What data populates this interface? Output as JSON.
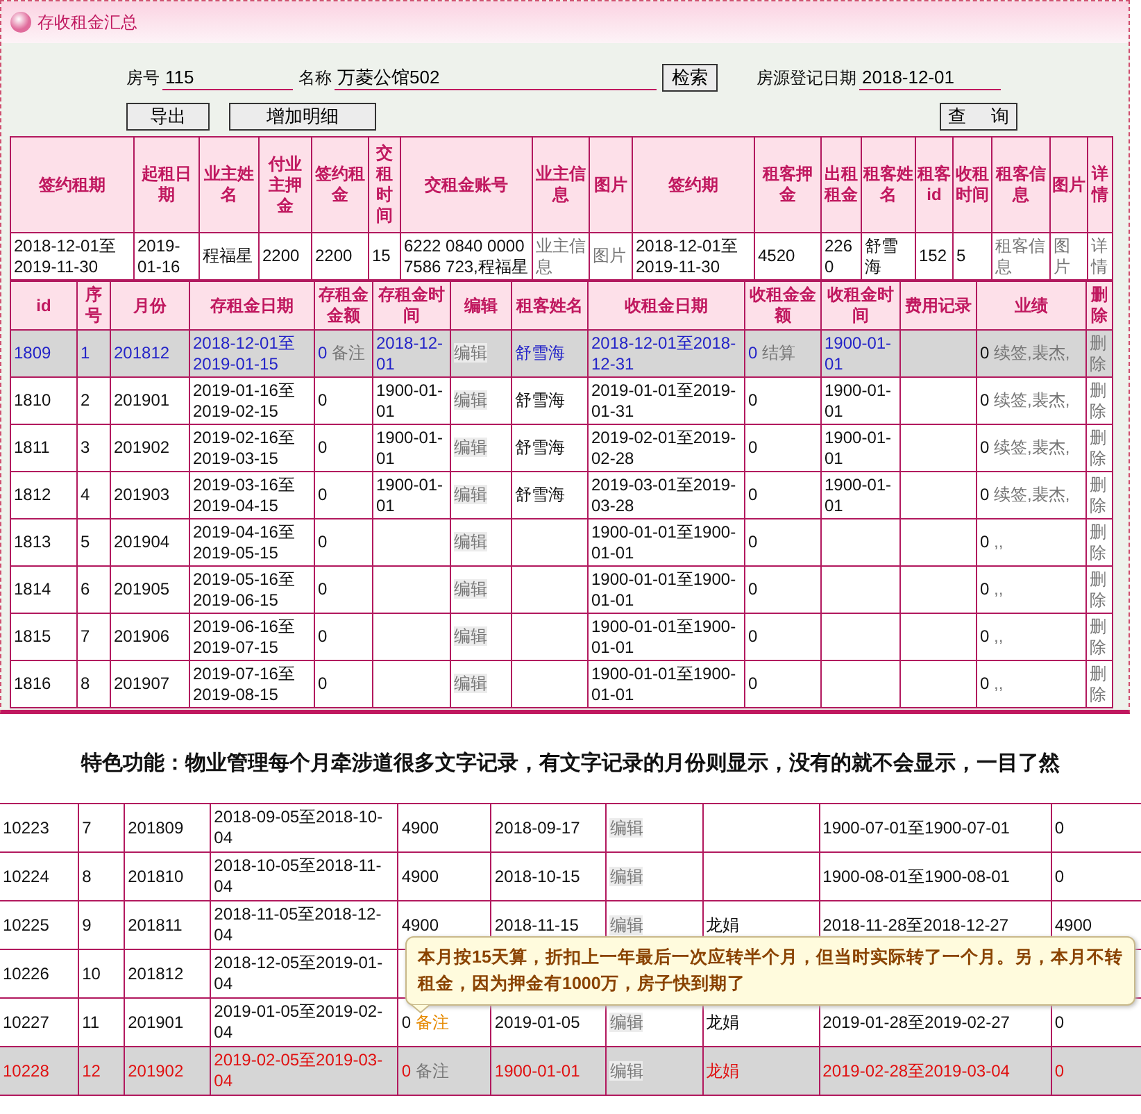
{
  "panel": {
    "title": "存收租金汇总"
  },
  "form": {
    "fields": [
      {
        "label": "房号",
        "value": "115"
      },
      {
        "label": "名称",
        "value": "万菱公馆502"
      }
    ],
    "search_button": "检索",
    "date_field": {
      "label": "房源登记日期",
      "value": "2018-12-01"
    },
    "buttons": [
      "导出",
      "增加明细"
    ],
    "query_button": "查 询"
  },
  "summary_table": {
    "columns": [
      "签约租期",
      "起租日期",
      "业主姓名",
      "付业主押金",
      "签约租金",
      "交租时间",
      "交租金账号",
      "业主信息",
      "图片",
      "签约期",
      "租客押金",
      "出租租金",
      "租客姓名",
      "租客id",
      "收租时间",
      "租客信息",
      "图片",
      "详情"
    ],
    "cells": [
      {
        "kind": "text",
        "text": "2018-12-01至2019-11-30"
      },
      {
        "kind": "text",
        "text": "2019-01-16"
      },
      {
        "kind": "text",
        "text": "程福星"
      },
      {
        "kind": "text",
        "text": "2200"
      },
      {
        "kind": "text",
        "text": "2200"
      },
      {
        "kind": "text",
        "text": "15"
      },
      {
        "kind": "text",
        "text": "6222 0840 0000 7586 723,程福星"
      },
      {
        "kind": "link",
        "text": "业主信息"
      },
      {
        "kind": "link",
        "text": "图片"
      },
      {
        "kind": "text",
        "text": "2018-12-01至2019-11-30"
      },
      {
        "kind": "text",
        "text": "4520"
      },
      {
        "kind": "text",
        "text": "2260"
      },
      {
        "kind": "text",
        "text": "舒雪海"
      },
      {
        "kind": "text",
        "text": "152"
      },
      {
        "kind": "text",
        "text": "5"
      },
      {
        "kind": "link",
        "text": "租客信息"
      },
      {
        "kind": "link",
        "text": "图片"
      },
      {
        "kind": "link",
        "text": "详情"
      }
    ]
  },
  "detail_table": {
    "columns": [
      "id",
      "序号",
      "月份",
      "存租金日期",
      "存租金金额",
      "存租金时间",
      "编辑",
      "租客姓名",
      "收租金日期",
      "收租金金额",
      "收租金时间",
      "费用记录",
      "业绩",
      "删除"
    ],
    "rows": [
      {
        "id": "1809",
        "seq": "1",
        "month": "201812",
        "deposit_period": "2018-12-01至2019-01-15",
        "deposit_amount": "0",
        "deposit_note": "备注",
        "deposit_time": "2018-12-01",
        "edit": "编辑",
        "tenant": "舒雪海",
        "collect_period": "2018-12-01至2018-12-31",
        "collect_amount": "0",
        "collect_note": "结算",
        "collect_time": "1900-01-01",
        "perf_amount": "0",
        "perf_text": "续签,裴杰,",
        "delete": "删除",
        "selected": true
      },
      {
        "id": "1810",
        "seq": "2",
        "month": "201901",
        "deposit_period": "2019-01-16至2019-02-15",
        "deposit_amount": "0",
        "deposit_time": "1900-01-01",
        "edit": "编辑",
        "tenant": "舒雪海",
        "collect_period": "2019-01-01至2019-01-31",
        "collect_amount": "0",
        "collect_time": "1900-01-01",
        "perf_amount": "0",
        "perf_text": "续签,裴杰,",
        "delete": "删除",
        "selected": false
      },
      {
        "id": "1811",
        "seq": "3",
        "month": "201902",
        "deposit_period": "2019-02-16至2019-03-15",
        "deposit_amount": "0",
        "deposit_time": "1900-01-01",
        "edit": "编辑",
        "tenant": "舒雪海",
        "collect_period": "2019-02-01至2019-02-28",
        "collect_amount": "0",
        "collect_time": "1900-01-01",
        "perf_amount": "0",
        "perf_text": "续签,裴杰,",
        "delete": "删除",
        "selected": false
      },
      {
        "id": "1812",
        "seq": "4",
        "month": "201903",
        "deposit_period": "2019-03-16至2019-04-15",
        "deposit_amount": "0",
        "deposit_time": "1900-01-01",
        "edit": "编辑",
        "tenant": "舒雪海",
        "collect_period": "2019-03-01至2019-03-28",
        "collect_amount": "0",
        "collect_time": "1900-01-01",
        "perf_amount": "0",
        "perf_text": "续签,裴杰,",
        "delete": "删除",
        "selected": false
      },
      {
        "id": "1813",
        "seq": "5",
        "month": "201904",
        "deposit_period": "2019-04-16至2019-05-15",
        "deposit_amount": "0",
        "edit": "编辑",
        "collect_period": "1900-01-01至1900-01-01",
        "collect_amount": "0",
        "perf_amount": "0",
        "perf_text": ",,",
        "delete": "删除",
        "selected": false
      },
      {
        "id": "1814",
        "seq": "6",
        "month": "201905",
        "deposit_period": "2019-05-16至2019-06-15",
        "deposit_amount": "0",
        "edit": "编辑",
        "collect_period": "1900-01-01至1900-01-01",
        "collect_amount": "0",
        "perf_amount": "0",
        "perf_text": ",,",
        "delete": "删除",
        "selected": false
      },
      {
        "id": "1815",
        "seq": "7",
        "month": "201906",
        "deposit_period": "2019-06-16至2019-07-15",
        "deposit_amount": "0",
        "edit": "编辑",
        "collect_period": "1900-01-01至1900-01-01",
        "collect_amount": "0",
        "perf_amount": "0",
        "perf_text": ",,",
        "delete": "删除",
        "selected": false
      },
      {
        "id": "1816",
        "seq": "8",
        "month": "201907",
        "deposit_period": "2019-07-16至2019-08-15",
        "deposit_amount": "0",
        "edit": "编辑",
        "collect_period": "1900-01-01至1900-01-01",
        "collect_amount": "0",
        "perf_amount": "0",
        "perf_text": ",,",
        "delete": "删除",
        "selected": false
      }
    ]
  },
  "caption": "特色功能：物业管理每个月牵涉道很多文字记录，有文字记录的月份则显示，没有的就不会显示，一目了然",
  "lower_table": {
    "rows": [
      {
        "id": "10223",
        "seq": "7",
        "month": "201809",
        "period": "2018-09-05至2018-10-04",
        "amount": "4900",
        "date": "2018-09-17",
        "edit": "编辑",
        "range": "1900-07-01至1900-07-01",
        "value": "0",
        "selected": false
      },
      {
        "id": "10224",
        "seq": "8",
        "month": "201810",
        "period": "2018-10-05至2018-11-04",
        "amount": "4900",
        "date": "2018-10-15",
        "edit": "编辑",
        "range": "1900-08-01至1900-08-01",
        "value": "0",
        "selected": false
      },
      {
        "id": "10225",
        "seq": "9",
        "month": "201811",
        "period": "2018-11-05至2018-12-04",
        "amount": "4900",
        "date": "2018-11-15",
        "edit": "编辑",
        "tenant": "龙娟",
        "range": "2018-11-28至2018-12-27",
        "value": "4900",
        "selected": false
      },
      {
        "id": "10226",
        "seq": "10",
        "month": "201812",
        "period": "2018-12-05至2019-01-04",
        "selected": false
      },
      {
        "id": "10227",
        "seq": "11",
        "month": "201901",
        "period": "2019-01-05至2019-02-04",
        "amount": "0",
        "note": "备注",
        "note_highlighted": true,
        "date": "2019-01-05",
        "edit": "编辑",
        "tenant": "龙娟",
        "range": "2019-01-28至2019-02-27",
        "value": "0",
        "selected": false
      },
      {
        "id": "10228",
        "seq": "12",
        "month": "201902",
        "period": "2019-02-05至2019-03-04",
        "amount": "0",
        "note": "备注",
        "note_highlighted": false,
        "date": "1900-01-01",
        "edit": "编辑",
        "tenant": "龙娟",
        "range": "2019-02-28至2019-03-04",
        "value": "0",
        "selected": true
      }
    ]
  },
  "tooltip": {
    "text": "本月按15天算，折扣上一年最后一次应转半个月，但当时实际转了一个月。另，本月不转租金，因为押金有1000万，房子快到期了"
  }
}
